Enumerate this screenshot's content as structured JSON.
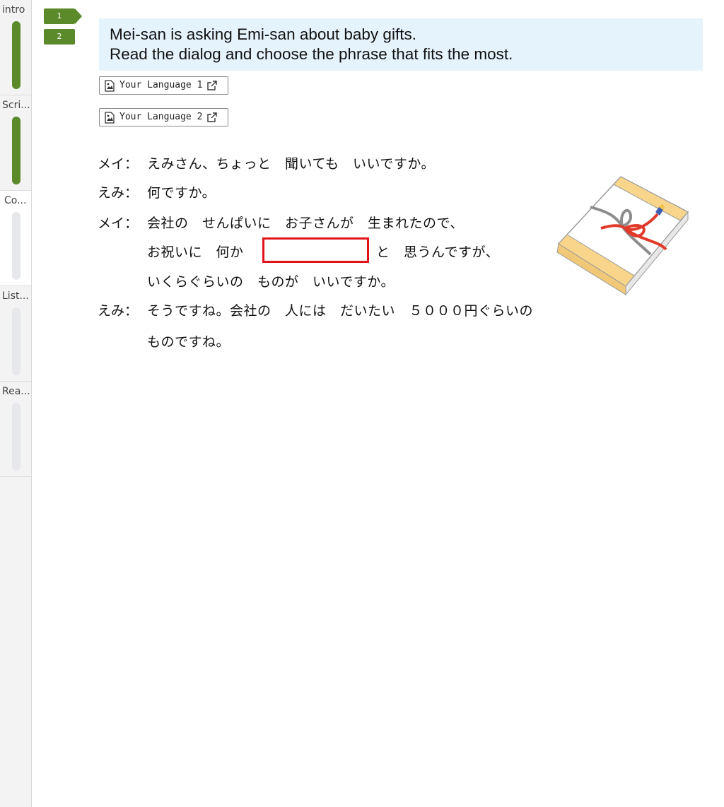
{
  "sidebar": {
    "sections": [
      {
        "label": "intro",
        "progress": 1.0
      },
      {
        "label": "Scri...",
        "progress": 1.0
      },
      {
        "label": "Co...",
        "progress": 0.0
      },
      {
        "label": "List...",
        "progress": 0.0
      },
      {
        "label": "Rea...",
        "progress": 0.0
      }
    ]
  },
  "steps": [
    "1",
    "2"
  ],
  "instruction": {
    "line1": "Mei-san is asking Emi-san about baby gifts.",
    "line2": "Read the dialog and choose the phrase that fits the most."
  },
  "language_buttons": [
    {
      "label": "Your Language 1"
    },
    {
      "label": "Your Language 2"
    }
  ],
  "dialog": {
    "speakers": [
      "メイ：",
      "えみ：",
      "メイ：",
      "えみ："
    ],
    "line1": "えみさん、ちょっと　聞いても　いいですか。",
    "line2": "何ですか。",
    "line3a": "会社の　せんぱいに　お子さんが　生まれたので、",
    "line3b_before": "お祝いに　何か",
    "line3b_after": "と　思うんですが、",
    "line3c": "いくらぐらいの　ものが　いいですか。",
    "line4a": "そうですね。会社の　人には　だいたい　５０００円ぐらいの",
    "line4b": "ものですね。"
  },
  "colors": {
    "accent_green": "#5a8a2a",
    "instruction_bg": "#e5f3fc",
    "blank_border": "#e0141a"
  }
}
